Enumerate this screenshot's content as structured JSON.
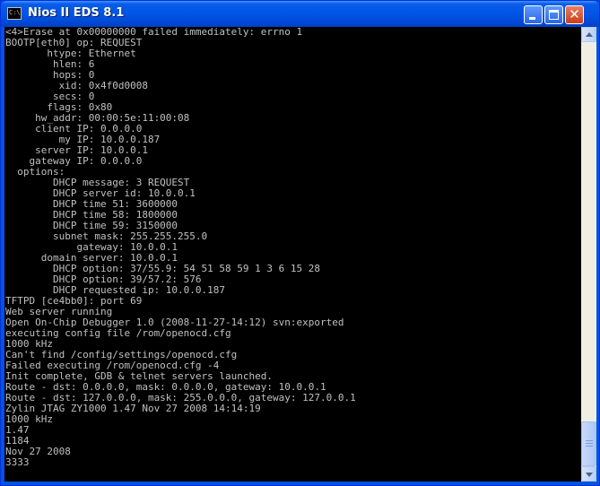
{
  "window": {
    "title": "Nios II EDS 8.1",
    "app_icon_text": "C:\\"
  },
  "console": {
    "lines": [
      "<4>Erase at 0x00000000 failed immediately: errno 1",
      "BOOTP[eth0] op: REQUEST",
      "       htype: Ethernet",
      "        hlen: 6",
      "        hops: 0",
      "         xid: 0x4f0d0008",
      "        secs: 0",
      "       flags: 0x80",
      "     hw_addr: 00:00:5e:11:00:08",
      "     client IP: 0.0.0.0",
      "         my IP: 10.0.0.187",
      "     server IP: 10.0.0.1",
      "    gateway IP: 0.0.0.0",
      "  options:",
      "        DHCP message: 3 REQUEST",
      "        DHCP server id: 10.0.0.1",
      "        DHCP time 51: 3600000",
      "        DHCP time 58: 1800000",
      "        DHCP time 59: 3150000",
      "        subnet mask: 255.255.255.0",
      "            gateway: 10.0.0.1",
      "      domain server: 10.0.0.1",
      "        DHCP option: 37/55.9: 54 51 58 59 1 3 6 15 28",
      "        DHCP option: 39/57.2: 576",
      "        DHCP requested ip: 10.0.0.187",
      "TFTPD [ce4bb0]: port 69",
      "Web server running",
      "Open On-Chip Debugger 1.0 (2008-11-27-14:12) svn:exported",
      "executing config file /rom/openocd.cfg",
      "1000 kHz",
      "Can't find /config/settings/openocd.cfg",
      "Failed executing /rom/openocd.cfg -4",
      "Init complete, GDB & telnet servers launched.",
      "Route - dst: 0.0.0.0, mask: 0.0.0.0, gateway: 10.0.0.1",
      "Route - dst: 127.0.0.0, mask: 255.0.0.0, gateway: 127.0.0.1",
      "Zylin JTAG ZY1000 1.47 Nov 27 2008 14:14:19",
      "1000 kHz",
      "1.47",
      "1184",
      "Nov 27 2008",
      "3333"
    ]
  },
  "colors": {
    "console_background": "#000000",
    "console_text": "#c0c0c0",
    "titlebar": "#0055e5"
  }
}
